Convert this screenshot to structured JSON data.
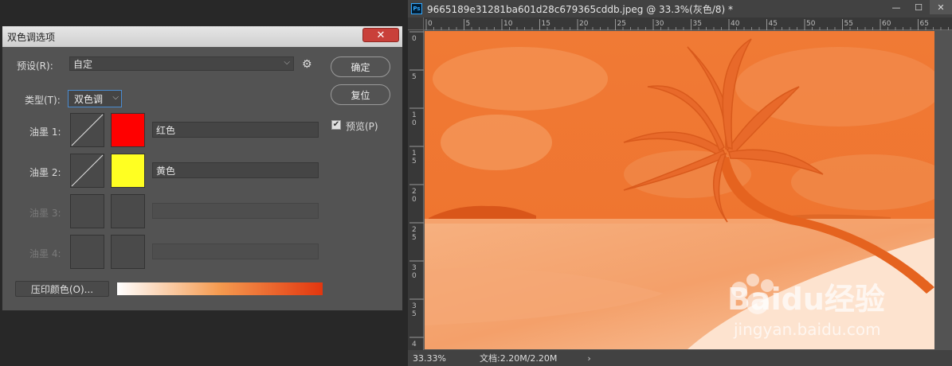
{
  "dialog": {
    "title": "双色调选项",
    "close_glyph": "✕",
    "preset_label": "预设(R):",
    "preset_value": "自定",
    "type_label": "类型(T):",
    "type_value": "双色调",
    "ok_label": "确定",
    "reset_label": "复位",
    "preview_label": "预览(P)",
    "preview_checked": true,
    "inks": [
      {
        "label": "油墨 1:",
        "name": "红色",
        "color": "#ff0000",
        "enabled": true
      },
      {
        "label": "油墨 2:",
        "name": "黄色",
        "color": "#ffff22",
        "enabled": true
      },
      {
        "label": "油墨 3:",
        "name": "",
        "color": "#4a4a4a",
        "enabled": false
      },
      {
        "label": "油墨 4:",
        "name": "",
        "color": "#4a4a4a",
        "enabled": false
      }
    ],
    "overprint_label": "压印颜色(O)..."
  },
  "document": {
    "app_icon": "Ps",
    "title": "9665189e31281ba601d28c679365cddb.jpeg @ 33.3%(灰色/8) *",
    "minimize_glyph": "—",
    "maximize_glyph": "☐",
    "close_glyph": "✕",
    "ruler_h_ticks": [
      "0",
      "5",
      "10",
      "15",
      "20",
      "25",
      "30",
      "35",
      "40",
      "45",
      "50",
      "55",
      "60",
      "65"
    ],
    "ruler_v_ticks": [
      "0",
      "5",
      "1\n0",
      "1\n5",
      "2\n0",
      "2\n5",
      "3\n0",
      "3\n5",
      "4\n0"
    ],
    "zoom": "33.33%",
    "doc_info": "文档:2.20M/2.20M",
    "status_arrow": "›",
    "watermark": "Baidu经验",
    "watermark_url": "jingyan.baidu.com",
    "tint_color": "#f47a30"
  }
}
